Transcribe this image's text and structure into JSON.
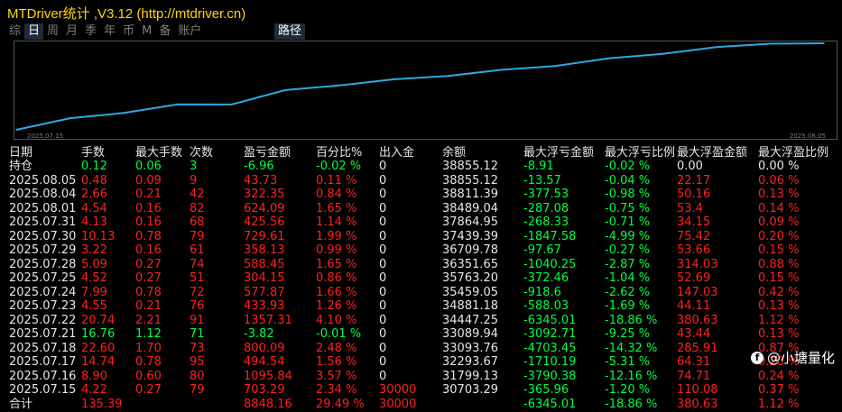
{
  "window": {
    "title": "MTDriver统计 ,V3.12 (http://mtdriver.cn)"
  },
  "tabs": [
    {
      "label": "综",
      "active": false
    },
    {
      "label": "日",
      "active": true
    },
    {
      "label": "周",
      "active": false
    },
    {
      "label": "月",
      "active": false
    },
    {
      "label": "季",
      "active": false
    },
    {
      "label": "年",
      "active": false
    },
    {
      "label": "币",
      "active": false
    },
    {
      "label": "M",
      "active": false
    },
    {
      "label": "备",
      "active": false
    },
    {
      "label": "账户",
      "active": false
    }
  ],
  "path_tab": {
    "label": "路径"
  },
  "chart": {
    "start_date": "2025.07.15",
    "end_date": "2025.08.05",
    "line_color": "#2ea8e0",
    "points": [
      {
        "date": "2025.07.15",
        "balance": 30703.29
      },
      {
        "date": "2025.07.16",
        "balance": 31799.13
      },
      {
        "date": "2025.07.17",
        "balance": 32293.67
      },
      {
        "date": "2025.07.18",
        "balance": 33093.76
      },
      {
        "date": "2025.07.21",
        "balance": 33089.94
      },
      {
        "date": "2025.07.22",
        "balance": 34447.25
      },
      {
        "date": "2025.07.23",
        "balance": 34881.18
      },
      {
        "date": "2025.07.24",
        "balance": 35459.05
      },
      {
        "date": "2025.07.25",
        "balance": 35763.2
      },
      {
        "date": "2025.07.28",
        "balance": 36351.65
      },
      {
        "date": "2025.07.29",
        "balance": 36709.78
      },
      {
        "date": "2025.07.30",
        "balance": 37439.39
      },
      {
        "date": "2025.07.31",
        "balance": 37864.95
      },
      {
        "date": "2025.08.01",
        "balance": 38489.04
      },
      {
        "date": "2025.08.04",
        "balance": 38811.39
      },
      {
        "date": "2025.08.05",
        "balance": 38855.12
      }
    ]
  },
  "table": {
    "headers": [
      "日期",
      "手数",
      "最大手数",
      "次数",
      "盈亏金额",
      "百分比%",
      "出入金",
      "余额",
      "最大浮亏金额",
      "最大浮亏比例",
      "最大浮盈金额",
      "最大浮盈比例"
    ],
    "rows": [
      {
        "date": "持仓",
        "lots": "0.12",
        "max_lots": "0.06",
        "count": "3",
        "pnl": "-6.96",
        "pct": "-0.02 %",
        "deposit": "0",
        "balance": "38855.12",
        "max_float_loss": "-8.91",
        "max_float_loss_pct": "-0.02 %",
        "max_float_profit": "0.00",
        "max_float_profit_pct": "0.00 %",
        "tone": "green",
        "mfp_tone": "white"
      },
      {
        "date": "2025.08.05",
        "lots": "0.48",
        "max_lots": "0.09",
        "count": "9",
        "pnl": "43.73",
        "pct": "0.11 %",
        "deposit": "0",
        "balance": "38855.12",
        "max_float_loss": "-13.57",
        "max_float_loss_pct": "-0.04 %",
        "max_float_profit": "22.17",
        "max_float_profit_pct": "0.06 %",
        "tone": "red",
        "mfp_tone": "red"
      },
      {
        "date": "2025.08.04",
        "lots": "2.66",
        "max_lots": "0.21",
        "count": "42",
        "pnl": "322.35",
        "pct": "0.84 %",
        "deposit": "0",
        "balance": "38811.39",
        "max_float_loss": "-377.53",
        "max_float_loss_pct": "-0.98 %",
        "max_float_profit": "50.16",
        "max_float_profit_pct": "0.13 %",
        "tone": "red",
        "mfp_tone": "red"
      },
      {
        "date": "2025.08.01",
        "lots": "4.54",
        "max_lots": "0.16",
        "count": "82",
        "pnl": "624.09",
        "pct": "1.65 %",
        "deposit": "0",
        "balance": "38489.04",
        "max_float_loss": "-287.08",
        "max_float_loss_pct": "-0.75 %",
        "max_float_profit": "53.4",
        "max_float_profit_pct": "0.14 %",
        "tone": "red",
        "mfp_tone": "red"
      },
      {
        "date": "2025.07.31",
        "lots": "4.13",
        "max_lots": "0.16",
        "count": "68",
        "pnl": "425.56",
        "pct": "1.14 %",
        "deposit": "0",
        "balance": "37864.95",
        "max_float_loss": "-268.33",
        "max_float_loss_pct": "-0.71 %",
        "max_float_profit": "34.15",
        "max_float_profit_pct": "0.09 %",
        "tone": "red",
        "mfp_tone": "red"
      },
      {
        "date": "2025.07.30",
        "lots": "10.13",
        "max_lots": "0.78",
        "count": "79",
        "pnl": "729.61",
        "pct": "1.99 %",
        "deposit": "0",
        "balance": "37439.39",
        "max_float_loss": "-1847.58",
        "max_float_loss_pct": "-4.99 %",
        "max_float_profit": "75.42",
        "max_float_profit_pct": "0.20 %",
        "tone": "red",
        "mfp_tone": "red"
      },
      {
        "date": "2025.07.29",
        "lots": "3.22",
        "max_lots": "0.16",
        "count": "61",
        "pnl": "358.13",
        "pct": "0.99 %",
        "deposit": "0",
        "balance": "36709.78",
        "max_float_loss": "-97.67",
        "max_float_loss_pct": "-0.27 %",
        "max_float_profit": "53.66",
        "max_float_profit_pct": "0.15 %",
        "tone": "red",
        "mfp_tone": "red"
      },
      {
        "date": "2025.07.28",
        "lots": "5.09",
        "max_lots": "0.27",
        "count": "74",
        "pnl": "588.45",
        "pct": "1.65 %",
        "deposit": "0",
        "balance": "36351.65",
        "max_float_loss": "-1040.25",
        "max_float_loss_pct": "-2.87 %",
        "max_float_profit": "314.03",
        "max_float_profit_pct": "0.88 %",
        "tone": "red",
        "mfp_tone": "red"
      },
      {
        "date": "2025.07.25",
        "lots": "4.52",
        "max_lots": "0.27",
        "count": "51",
        "pnl": "304.15",
        "pct": "0.86 %",
        "deposit": "0",
        "balance": "35763.20",
        "max_float_loss": "-372.46",
        "max_float_loss_pct": "-1.04 %",
        "max_float_profit": "52.69",
        "max_float_profit_pct": "0.15 %",
        "tone": "red",
        "mfp_tone": "red"
      },
      {
        "date": "2025.07.24",
        "lots": "7.99",
        "max_lots": "0.78",
        "count": "72",
        "pnl": "577.87",
        "pct": "1.66 %",
        "deposit": "0",
        "balance": "35459.05",
        "max_float_loss": "-918.6",
        "max_float_loss_pct": "-2.62 %",
        "max_float_profit": "147.03",
        "max_float_profit_pct": "0.42 %",
        "tone": "red",
        "mfp_tone": "red"
      },
      {
        "date": "2025.07.23",
        "lots": "4.55",
        "max_lots": "0.21",
        "count": "76",
        "pnl": "433.93",
        "pct": "1.26 %",
        "deposit": "0",
        "balance": "34881.18",
        "max_float_loss": "-588.03",
        "max_float_loss_pct": "-1.69 %",
        "max_float_profit": "44.11",
        "max_float_profit_pct": "0.13 %",
        "tone": "red",
        "mfp_tone": "red"
      },
      {
        "date": "2025.07.22",
        "lots": "20.74",
        "max_lots": "2.21",
        "count": "91",
        "pnl": "1357.31",
        "pct": "4.10 %",
        "deposit": "0",
        "balance": "34447.25",
        "max_float_loss": "-6345.01",
        "max_float_loss_pct": "-18.86 %",
        "max_float_profit": "380.63",
        "max_float_profit_pct": "1.12 %",
        "tone": "red",
        "mfp_tone": "red"
      },
      {
        "date": "2025.07.21",
        "lots": "16.76",
        "max_lots": "1.12",
        "count": "71",
        "pnl": "-3.82",
        "pct": "-0.01 %",
        "deposit": "0",
        "balance": "33089.94",
        "max_float_loss": "-3092.71",
        "max_float_loss_pct": "-9.25 %",
        "max_float_profit": "43.44",
        "max_float_profit_pct": "0.13 %",
        "tone": "green",
        "mfp_tone": "red"
      },
      {
        "date": "2025.07.18",
        "lots": "22.60",
        "max_lots": "1.70",
        "count": "73",
        "pnl": "800.09",
        "pct": "2.48 %",
        "deposit": "0",
        "balance": "33093.76",
        "max_float_loss": "-4703.45",
        "max_float_loss_pct": "-14.32 %",
        "max_float_profit": "285.91",
        "max_float_profit_pct": "0.87 %",
        "tone": "red",
        "mfp_tone": "red"
      },
      {
        "date": "2025.07.17",
        "lots": "14.74",
        "max_lots": "0.78",
        "count": "95",
        "pnl": "494.54",
        "pct": "1.56 %",
        "deposit": "0",
        "balance": "32293.67",
        "max_float_loss": "-1710.19",
        "max_float_loss_pct": "-5.31 %",
        "max_float_profit": "64.31",
        "max_float_profit_pct": "0.20 %",
        "tone": "red",
        "mfp_tone": "red"
      },
      {
        "date": "2025.07.16",
        "lots": "8.90",
        "max_lots": "0.60",
        "count": "80",
        "pnl": "1095.84",
        "pct": "3.57 %",
        "deposit": "0",
        "balance": "31799.13",
        "max_float_loss": "-3790.38",
        "max_float_loss_pct": "-12.16 %",
        "max_float_profit": "74.71",
        "max_float_profit_pct": "0.24 %",
        "tone": "red",
        "mfp_tone": "red"
      },
      {
        "date": "2025.07.15",
        "lots": "4.22",
        "max_lots": "0.27",
        "count": "79",
        "pnl": "703.29",
        "pct": "2.34 %",
        "deposit": "30000",
        "balance": "30703.29",
        "max_float_loss": "-365.96",
        "max_float_loss_pct": "-1.20 %",
        "max_float_profit": "110.08",
        "max_float_profit_pct": "0.37 %",
        "tone": "red",
        "mfp_tone": "red",
        "deposit_red": true
      },
      {
        "date": "合计",
        "lots": "135.39",
        "max_lots": "",
        "count": "",
        "pnl": "8848.16",
        "pct": "29.49 %",
        "deposit": "30000",
        "balance": "",
        "max_float_loss": "-6345.01",
        "max_float_loss_pct": "-18.86 %",
        "max_float_profit": "380.63",
        "max_float_profit_pct": "1.12 %",
        "tone": "red",
        "mfp_tone": "red",
        "deposit_red": true
      }
    ]
  },
  "watermark": {
    "logo": "f",
    "text": "@小塘量化"
  }
}
